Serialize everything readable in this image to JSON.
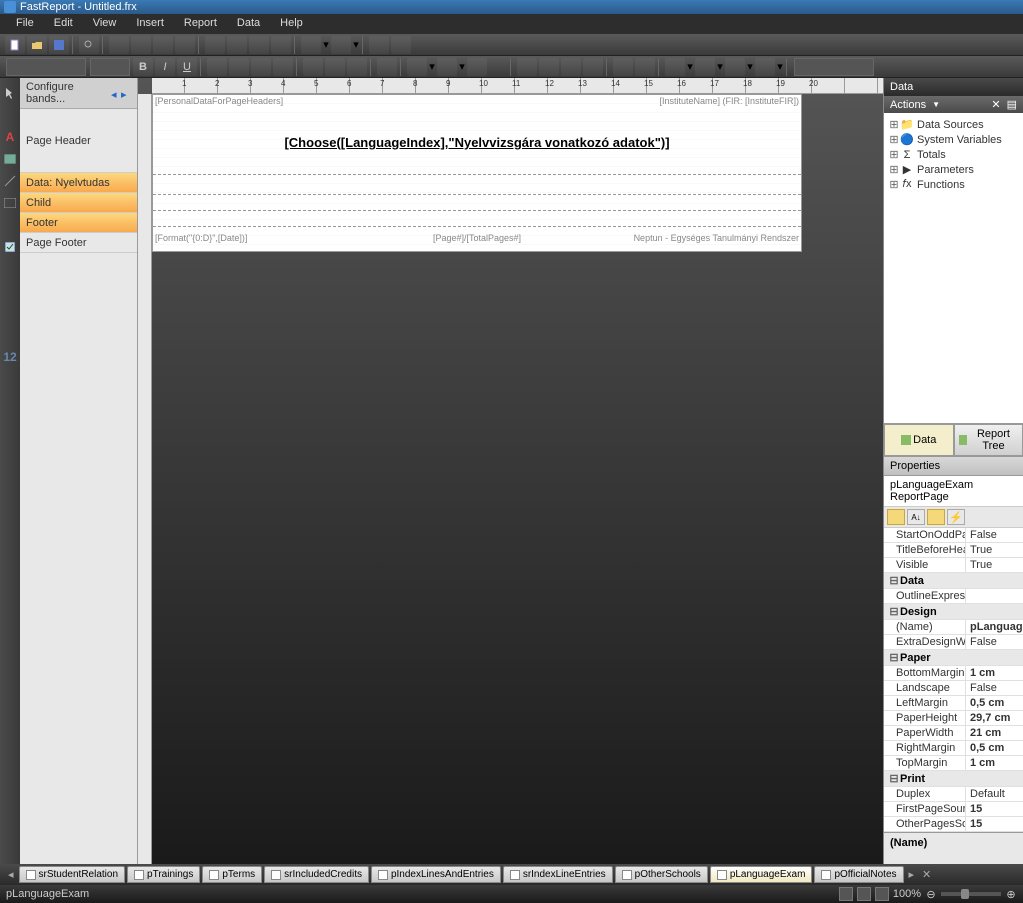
{
  "window": {
    "title": "FastReport - Untitled.frx"
  },
  "menu": {
    "items": [
      "File",
      "Edit",
      "View",
      "Insert",
      "Report",
      "Data",
      "Help"
    ]
  },
  "bands_panel": {
    "header": "Configure bands...",
    "items": [
      {
        "label": "Page Header",
        "selected": false,
        "tall": true
      },
      {
        "label": "Data: Nyelvtudas",
        "selected": true,
        "tall": false
      },
      {
        "label": "Child",
        "selected": true,
        "tall": false
      },
      {
        "label": "Footer",
        "selected": true,
        "tall": false
      },
      {
        "label": "Page Footer",
        "selected": false,
        "tall": false
      }
    ]
  },
  "design": {
    "header_left": "[PersonalDataForPageHeaders]",
    "header_right": "[InstituteName] (FIR: [InstituteFIR])",
    "title": "[Choose([LanguageIndex],\"Nyelvvizsgára vonatkozó adatok\")]",
    "footer_left": "[Format(\"{0:D}\",[Date])]",
    "footer_center": "[Page#]/[TotalPages#]",
    "footer_right": "Neptun - Egységes Tanulmányi Rendszer"
  },
  "ruler": {
    "marks": [
      1,
      2,
      3,
      4,
      5,
      6,
      7,
      8,
      9,
      10,
      11,
      12,
      13,
      14,
      15,
      16,
      17,
      18,
      19,
      20
    ]
  },
  "data_panel": {
    "header": "Data",
    "actions_label": "Actions",
    "tree": [
      {
        "label": "Data Sources",
        "icon": "folder"
      },
      {
        "label": "System Variables",
        "icon": "var"
      },
      {
        "label": "Totals",
        "icon": "sigma"
      },
      {
        "label": "Parameters",
        "icon": "param"
      },
      {
        "label": "Functions",
        "icon": "fx"
      }
    ],
    "tabs": [
      {
        "label": "Data",
        "active": true
      },
      {
        "label": "Report Tree",
        "active": false
      }
    ]
  },
  "properties": {
    "header": "Properties",
    "object": "pLanguageExam ReportPage",
    "groups": [
      {
        "cat": null,
        "rows": [
          {
            "name": "StartOnOddPage",
            "value": "False"
          },
          {
            "name": "TitleBeforeHeader",
            "value": "True"
          },
          {
            "name": "Visible",
            "value": "True"
          }
        ]
      },
      {
        "cat": "Data",
        "rows": [
          {
            "name": "OutlineExpression",
            "value": ""
          }
        ]
      },
      {
        "cat": "Design",
        "rows": [
          {
            "name": "(Name)",
            "value": "pLanguageExam",
            "bold": true
          },
          {
            "name": "ExtraDesignWidth",
            "value": "False"
          }
        ]
      },
      {
        "cat": "Paper",
        "rows": [
          {
            "name": "BottomMargin",
            "value": "1 cm",
            "bold": true
          },
          {
            "name": "Landscape",
            "value": "False"
          },
          {
            "name": "LeftMargin",
            "value": "0,5 cm",
            "bold": true
          },
          {
            "name": "PaperHeight",
            "value": "29,7 cm",
            "bold": true
          },
          {
            "name": "PaperWidth",
            "value": "21 cm",
            "bold": true
          },
          {
            "name": "RightMargin",
            "value": "0,5 cm",
            "bold": true
          },
          {
            "name": "TopMargin",
            "value": "1 cm",
            "bold": true
          }
        ]
      },
      {
        "cat": "Print",
        "rows": [
          {
            "name": "Duplex",
            "value": "Default"
          },
          {
            "name": "FirstPageSource",
            "value": "15",
            "bold": true
          },
          {
            "name": "OtherPagesSource",
            "value": "15",
            "bold": true
          }
        ]
      }
    ],
    "help_name": "(Name)"
  },
  "page_tabs": {
    "items": [
      "srStudentRelation",
      "pTrainings",
      "pTerms",
      "srIncludedCredits",
      "pIndexLinesAndEntries",
      "srIndexLineEntries",
      "pOtherSchools",
      "pLanguageExam",
      "pOfficialNotes"
    ],
    "active": "pLanguageExam"
  },
  "status": {
    "left": "pLanguageExam",
    "zoom": "100%"
  }
}
